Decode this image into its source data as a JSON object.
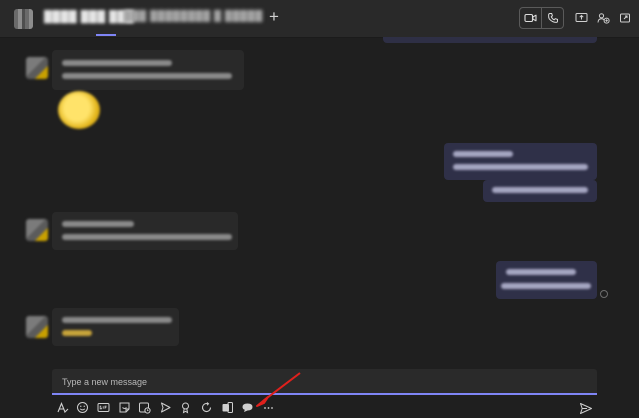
{
  "header": {
    "chat_name": "████ ███ ███",
    "tabs_text": "███ ████████ █ █████",
    "add_tab_symbol": "+"
  },
  "compose": {
    "placeholder": "Type a new message"
  },
  "colors": {
    "accent": "#7f85f5",
    "annotation_arrow": "#e0201c",
    "background": "#1f1f1f"
  },
  "toolbar_icons": [
    "format-icon",
    "emoji-icon",
    "gif-icon",
    "sticker-icon",
    "meet-now-icon",
    "schedule-icon",
    "praise-icon",
    "loop-icon",
    "forms-icon",
    "speech-bubble-icon",
    "more-options-icon"
  ]
}
